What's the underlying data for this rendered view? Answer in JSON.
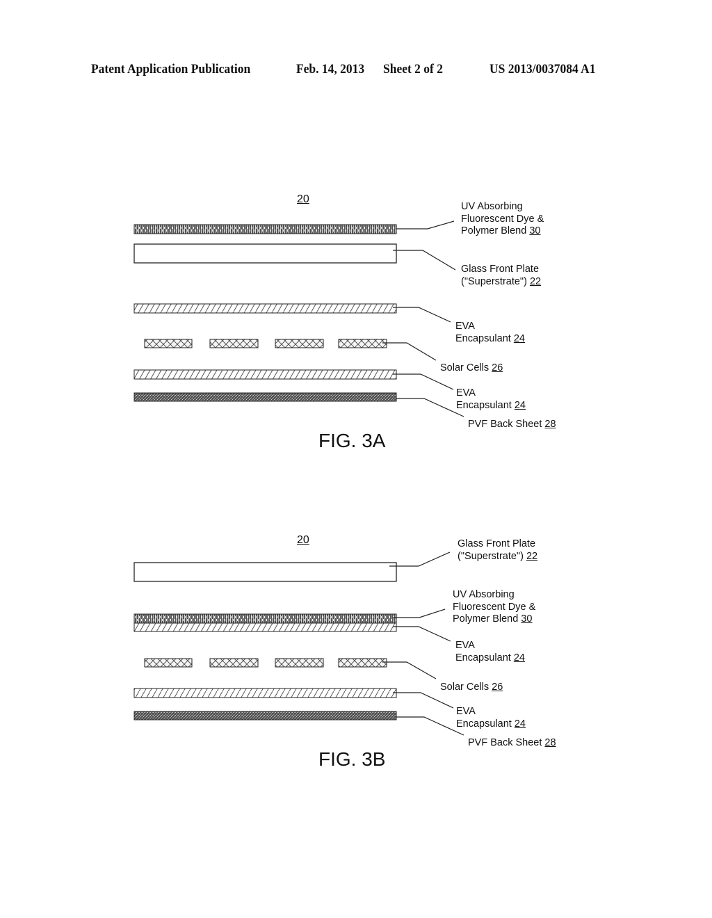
{
  "header": {
    "publication": "Patent Application Publication",
    "date": "Feb. 14, 2013",
    "sheet": "Sheet 2 of 2",
    "number": "US 2013/0037084 A1"
  },
  "figures": [
    {
      "id": "fig3a",
      "caption": "FIG. 3A",
      "assembly_ref": "20",
      "layers_top_to_bottom": [
        "UV Absorbing Fluorescent Dye & Polymer Blend",
        "Glass Front Plate",
        "EVA Encapsulant",
        "Solar Cells",
        "EVA Encapsulant",
        "PVF Back Sheet"
      ],
      "labels": [
        {
          "lines": [
            "UV Absorbing",
            "Fluorescent Dye &",
            "Polymer Blend "
          ],
          "ref": "30"
        },
        {
          "lines": [
            "Glass Front Plate",
            "(\"Superstrate\") "
          ],
          "ref": "22"
        },
        {
          "lines": [
            "EVA",
            "Encapsulant "
          ],
          "ref": "24"
        },
        {
          "lines": [
            "Solar Cells "
          ],
          "ref": "26"
        },
        {
          "lines": [
            "EVA",
            "Encapsulant  "
          ],
          "ref": "24"
        },
        {
          "lines": [
            "PVF Back Sheet  "
          ],
          "ref": "28"
        }
      ]
    },
    {
      "id": "fig3b",
      "caption": "FIG. 3B",
      "assembly_ref": "20",
      "layers_top_to_bottom": [
        "Glass Front Plate",
        "UV Absorbing Fluorescent Dye & Polymer Blend",
        "EVA Encapsulant",
        "Solar Cells",
        "EVA Encapsulant",
        "PVF Back Sheet"
      ],
      "labels": [
        {
          "lines": [
            "Glass Front Plate",
            "(\"Superstrate\") "
          ],
          "ref": "22"
        },
        {
          "lines": [
            "UV Absorbing",
            "Fluorescent Dye &",
            "Polymer Blend "
          ],
          "ref": "30"
        },
        {
          "lines": [
            "EVA",
            "Encapsulant "
          ],
          "ref": "24"
        },
        {
          "lines": [
            "Solar Cells "
          ],
          "ref": "26"
        },
        {
          "lines": [
            "EVA",
            "Encapsulant  "
          ],
          "ref": "24"
        },
        {
          "lines": [
            "PVF Back Sheet  "
          ],
          "ref": "28"
        }
      ]
    }
  ]
}
